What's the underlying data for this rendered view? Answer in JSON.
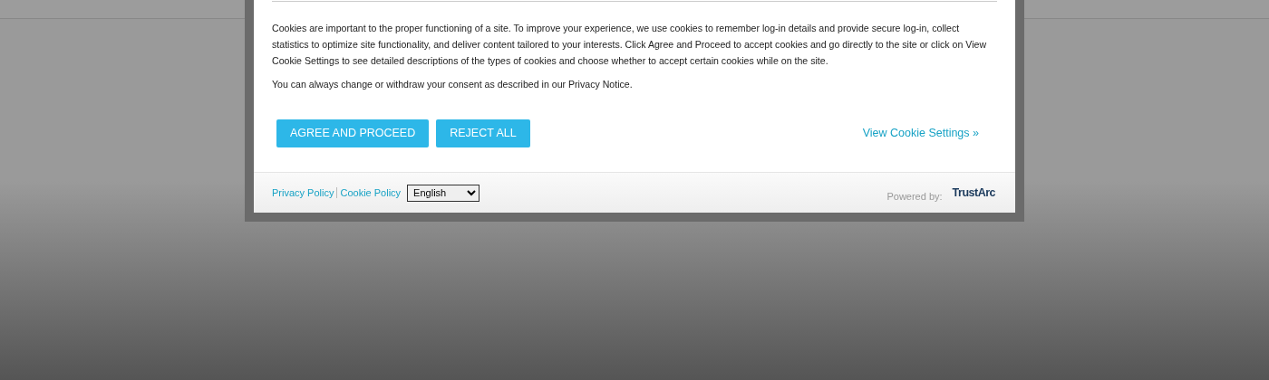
{
  "dialog": {
    "paragraphs": [
      "Cookies are important to the proper functioning of a site. To improve your experience, we use cookies to remember log-in details and provide secure log-in, collect statistics to optimize site functionality, and deliver content tailored to your interests. Click Agree and Proceed to accept cookies and go directly to the site or click on View Cookie Settings to see detailed descriptions of the types of cookies and choose whether to accept certain cookies while on the site.",
      "You can always change or withdraw your consent as described in our Privacy Notice."
    ],
    "buttons": [
      "AGREE AND PROCEED",
      "REJECT ALL"
    ],
    "settings_link": "View Cookie Settings »",
    "footer": {
      "links": [
        "Privacy Policy",
        "Cookie Policy"
      ],
      "language": {
        "value": "English"
      },
      "powered_by": "Powered by:",
      "logo": "TrustArc"
    }
  }
}
